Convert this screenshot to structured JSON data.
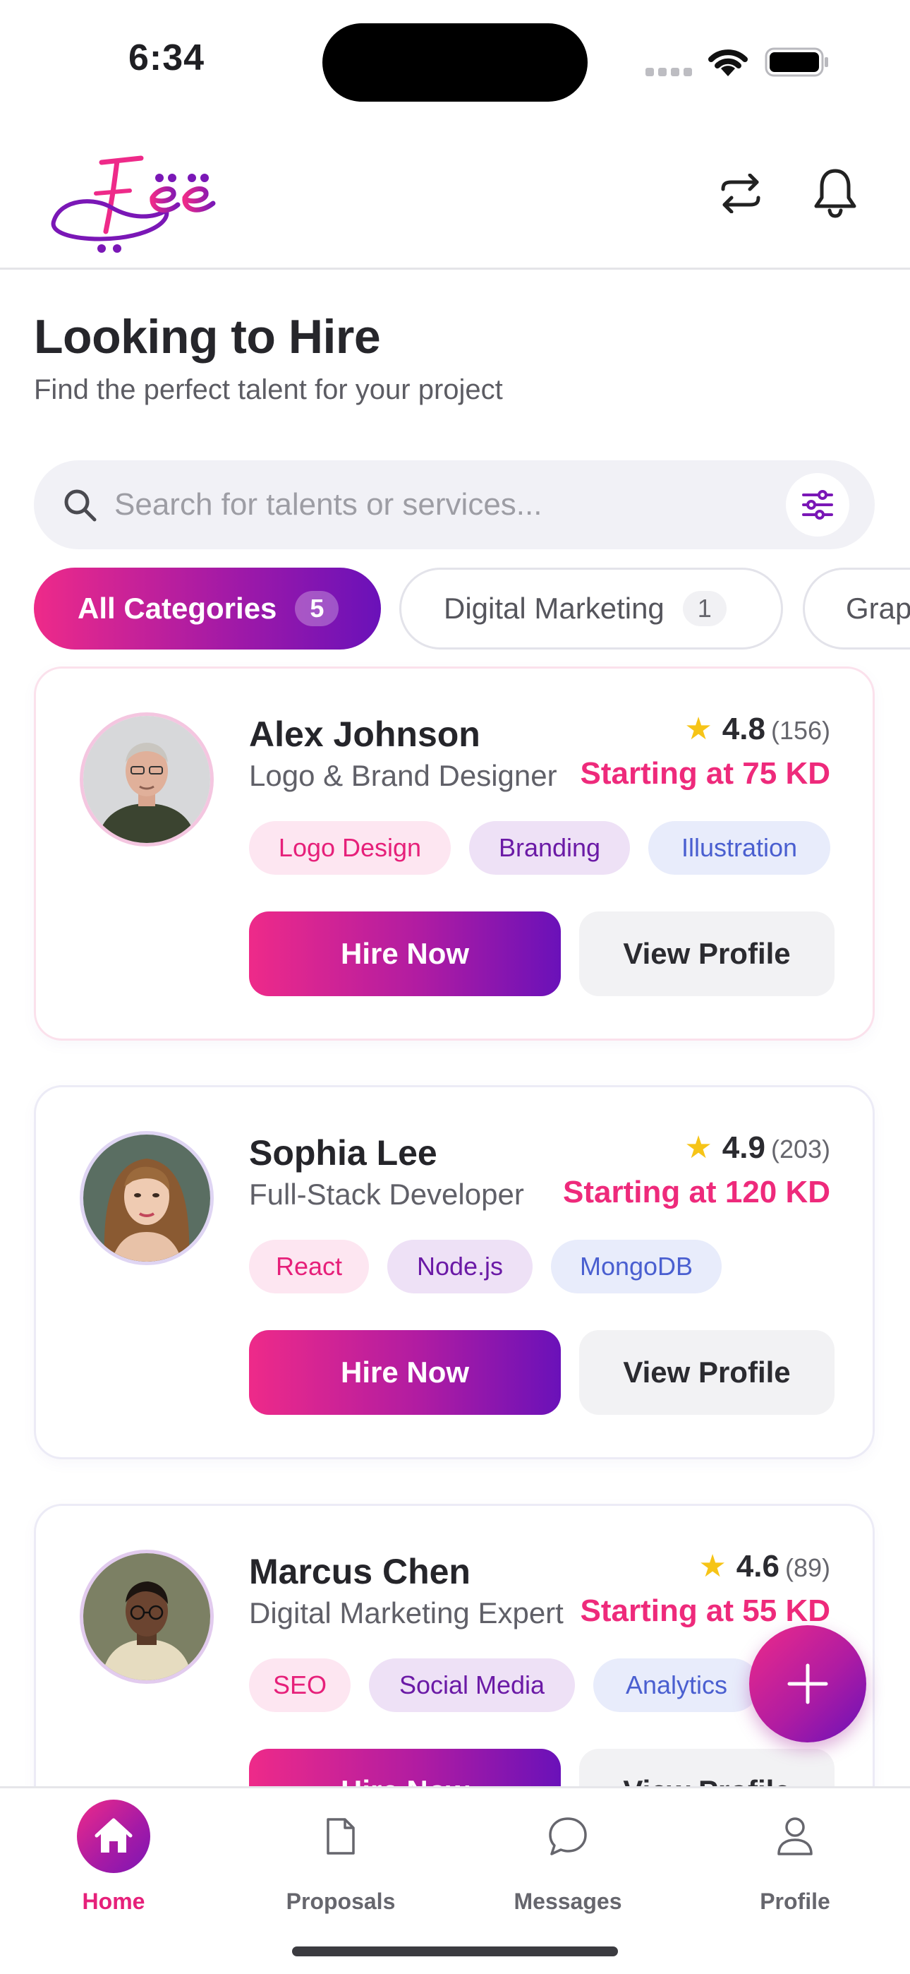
{
  "status_bar": {
    "time": "6:34"
  },
  "header": {
    "logo_alt": "Fëë"
  },
  "page": {
    "title": "Looking to Hire",
    "subtitle": "Find the perfect talent for your project"
  },
  "search": {
    "placeholder": "Search for talents or services..."
  },
  "categories": [
    {
      "label": "All Categories",
      "count": "5",
      "active": true
    },
    {
      "label": "Digital Marketing",
      "count": "1",
      "active": false
    },
    {
      "label": "Grap",
      "count": "",
      "active": false
    }
  ],
  "cards": [
    {
      "name": "Alex Johnson",
      "role": "Logo & Brand Designer",
      "rating": "4.8",
      "reviews": "(156)",
      "price": "Starting at 75 KD",
      "tags": [
        "Logo Design",
        "Branding",
        "Illustration"
      ],
      "hire_label": "Hire Now",
      "view_label": "View Profile"
    },
    {
      "name": "Sophia Lee",
      "role": "Full-Stack Developer",
      "rating": "4.9",
      "reviews": "(203)",
      "price": "Starting at 120 KD",
      "tags": [
        "React",
        "Node.js",
        "MongoDB"
      ],
      "hire_label": "Hire Now",
      "view_label": "View Profile"
    },
    {
      "name": "Marcus Chen",
      "role": "Digital Marketing Expert",
      "rating": "4.6",
      "reviews": "(89)",
      "price": "Starting at 55 KD",
      "tags": [
        "SEO",
        "Social Media",
        "Analytics"
      ],
      "hire_label": "Hire Now",
      "view_label": "View Profile"
    }
  ],
  "bottom_nav": [
    {
      "label": "Home",
      "icon": "home-icon",
      "active": true
    },
    {
      "label": "Proposals",
      "icon": "document-icon",
      "active": false
    },
    {
      "label": "Messages",
      "icon": "chat-bubble-icon",
      "active": false
    },
    {
      "label": "Profile",
      "icon": "user-icon",
      "active": false
    }
  ],
  "colors": {
    "brand_pink": "#ee2a89",
    "brand_purple": "#6a11b9",
    "price": "#ee2a7b",
    "star": "#f6c417"
  }
}
